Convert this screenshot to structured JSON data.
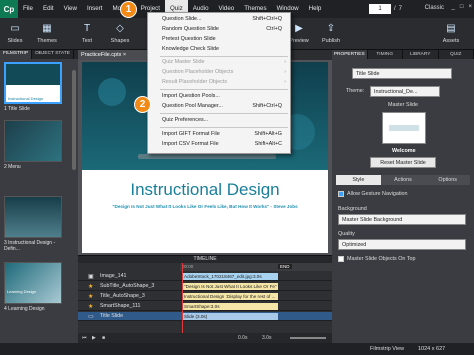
{
  "app": {
    "logo": "Cp"
  },
  "menubar": {
    "items": [
      "File",
      "Edit",
      "View",
      "Insert",
      "Modify",
      "Project",
      "Quiz",
      "Audio",
      "Video",
      "Themes",
      "Window",
      "Help"
    ],
    "page_current": "1",
    "page_total": "7",
    "mode": "Classic",
    "window_controls": [
      "_",
      "□",
      "×"
    ]
  },
  "toolbar": {
    "slides": "Slides",
    "themes": "Themes",
    "text": "Text",
    "shapes": "Shapes",
    "preview": "Preview",
    "publish": "Publish",
    "assets": "Assets"
  },
  "filmstrip": {
    "tabs": [
      "FILMSTRIP",
      "OBJECT STATE"
    ],
    "slides": [
      {
        "label": "1 Title Slide",
        "caption": "Instructional Design"
      },
      {
        "label": "2 Menu",
        "caption": ""
      },
      {
        "label": "3 Instructional Design - Defin...",
        "caption": ""
      },
      {
        "label": "4 Learning Design",
        "caption": "Learning Design"
      }
    ]
  },
  "document_tab": "PracticeFile.cptx ×",
  "slide": {
    "title": "Instructional Design",
    "subtitle": "\"Design Is Not Just What It Looks Like Or Feels Like, But How It Works\" - Steve Jobs"
  },
  "quiz_menu": {
    "items": [
      {
        "label": "Question Slide...",
        "shortcut": "Shift+Ctrl+Q",
        "disabled": false
      },
      {
        "label": "Random Question Slide",
        "shortcut": "Ctrl+Q",
        "disabled": false
      },
      {
        "label": "Pretest Question Slide",
        "shortcut": "",
        "disabled": false
      },
      {
        "label": "Knowledge Check Slide",
        "shortcut": "",
        "disabled": false
      },
      {
        "label": "Quiz Master Slide",
        "shortcut": "",
        "disabled": true,
        "submenu": true
      },
      {
        "label": "Question Placeholder Objects",
        "shortcut": "",
        "disabled": true,
        "submenu": true
      },
      {
        "label": "Result Placeholder Objects",
        "shortcut": "",
        "disabled": true,
        "submenu": true
      },
      {
        "label": "Import Question Pools...",
        "shortcut": "",
        "disabled": false
      },
      {
        "label": "Question Pool Manager...",
        "shortcut": "Shift+Ctrl+Q",
        "disabled": false
      },
      {
        "label": "Quiz Preferences...",
        "shortcut": "",
        "disabled": false
      },
      {
        "label": "Import GIFT Format File",
        "shortcut": "Shift+Alt+G",
        "disabled": false
      },
      {
        "label": "Import CSV Format File",
        "shortcut": "Shift+Alt+C",
        "disabled": false
      }
    ]
  },
  "badges": [
    "1",
    "2"
  ],
  "timeline": {
    "title": "TIMELINE",
    "ruler_start": "00:00",
    "ruler_end": "END",
    "rows": [
      {
        "name": "Image_141",
        "bar": "AdobeStock_170218467_edit.jpg:3.0s",
        "color": "#a7d3f0",
        "selected": false
      },
      {
        "name": "SubTitle_AutoShape_3",
        "bar": "\"Design Is Not Just What It Looks Like Or Fe\"",
        "color": "#f5e6a8",
        "selected": false
      },
      {
        "name": "Title_AutoShape_3",
        "bar": "Instructional Design :Display for the rest of ...",
        "color": "#f5e6a8",
        "selected": false
      },
      {
        "name": "SmartShape_111",
        "bar": "SmartShape:3.0s",
        "color": "#f5e6a8",
        "selected": false
      },
      {
        "name": "Title Slide",
        "bar": "Slide (3.0s)",
        "color": "#a9c9e8",
        "selected": true
      }
    ],
    "footer_time": "0.0s",
    "footer_duration": "3.0s"
  },
  "properties": {
    "tabs": [
      "PROPERTIES",
      "TIMING",
      "LIBRARY",
      "QUIZ"
    ],
    "slide_name": "Title Slide",
    "theme_label": "Theme:",
    "theme_value": "Instructional_De...",
    "master_slide_label": "Master Slide",
    "master_slide_name": "Welcome",
    "reset_master": "Reset Master Slide",
    "subtabs": [
      "Style",
      "Actions",
      "Options"
    ],
    "allow_gesture": "Allow Gesture Navigation",
    "background_label": "Background",
    "background_value": "Master Slide Background",
    "quality_label": "Quality",
    "quality_value": "Optimized",
    "objects_on_top": "Master Slide Objects On Top"
  },
  "statusbar": {
    "view": "Filmstrip View",
    "size": "1024 x 627"
  }
}
